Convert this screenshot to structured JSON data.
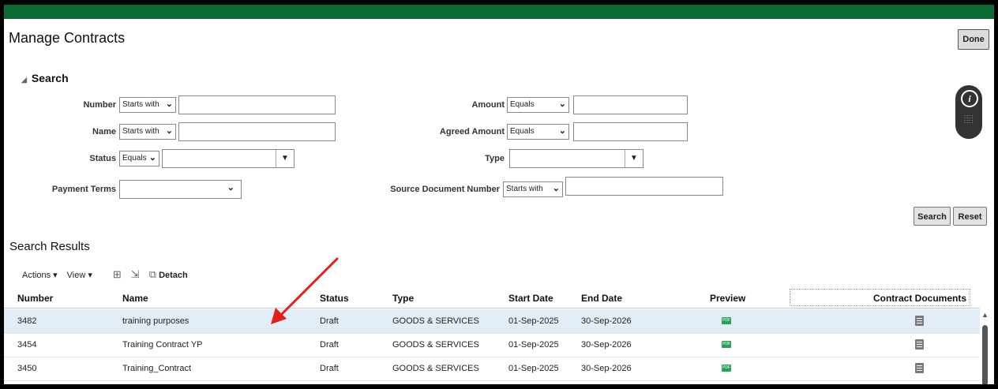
{
  "page": {
    "title": "Manage Contracts",
    "done_label": "Done"
  },
  "search": {
    "section_label": "Search",
    "fields": {
      "number": {
        "label": "Number",
        "operator": "Starts with"
      },
      "name": {
        "label": "Name",
        "operator": "Starts with"
      },
      "status": {
        "label": "Status",
        "operator": "Equals"
      },
      "payment_terms": {
        "label": "Payment Terms"
      },
      "amount": {
        "label": "Amount",
        "operator": "Equals"
      },
      "agreed_amount": {
        "label": "Agreed Amount",
        "operator": "Equals"
      },
      "type": {
        "label": "Type"
      },
      "source_document_number": {
        "label": "Source Document Number",
        "operator": "Starts with"
      }
    },
    "search_button": "Search",
    "reset_button": "Reset"
  },
  "results": {
    "title": "Search Results",
    "toolbar": {
      "actions": "Actions",
      "view": "View",
      "detach": "Detach"
    },
    "columns": [
      "Number",
      "Name",
      "Status",
      "Type",
      "Start Date",
      "End Date",
      "Preview",
      "Contract Documents"
    ],
    "rows": [
      {
        "number": "3482",
        "name": "training purposes",
        "status": "Draft",
        "type": "GOODS & SERVICES",
        "start": "01-Sep-2025",
        "end": "30-Sep-2026"
      },
      {
        "number": "3454",
        "name": "Training Contract YP",
        "status": "Draft",
        "type": "GOODS & SERVICES",
        "start": "01-Sep-2025",
        "end": "30-Sep-2026"
      },
      {
        "number": "3450",
        "name": "Training_Contract",
        "status": "Draft",
        "type": "GOODS & SERVICES",
        "start": "01-Sep-2025",
        "end": "30-Sep-2026"
      }
    ]
  },
  "colors": {
    "brand_bar": "#0b6b35",
    "selected_row": "#e3edf8",
    "annotation_arrow": "#e0201b"
  }
}
